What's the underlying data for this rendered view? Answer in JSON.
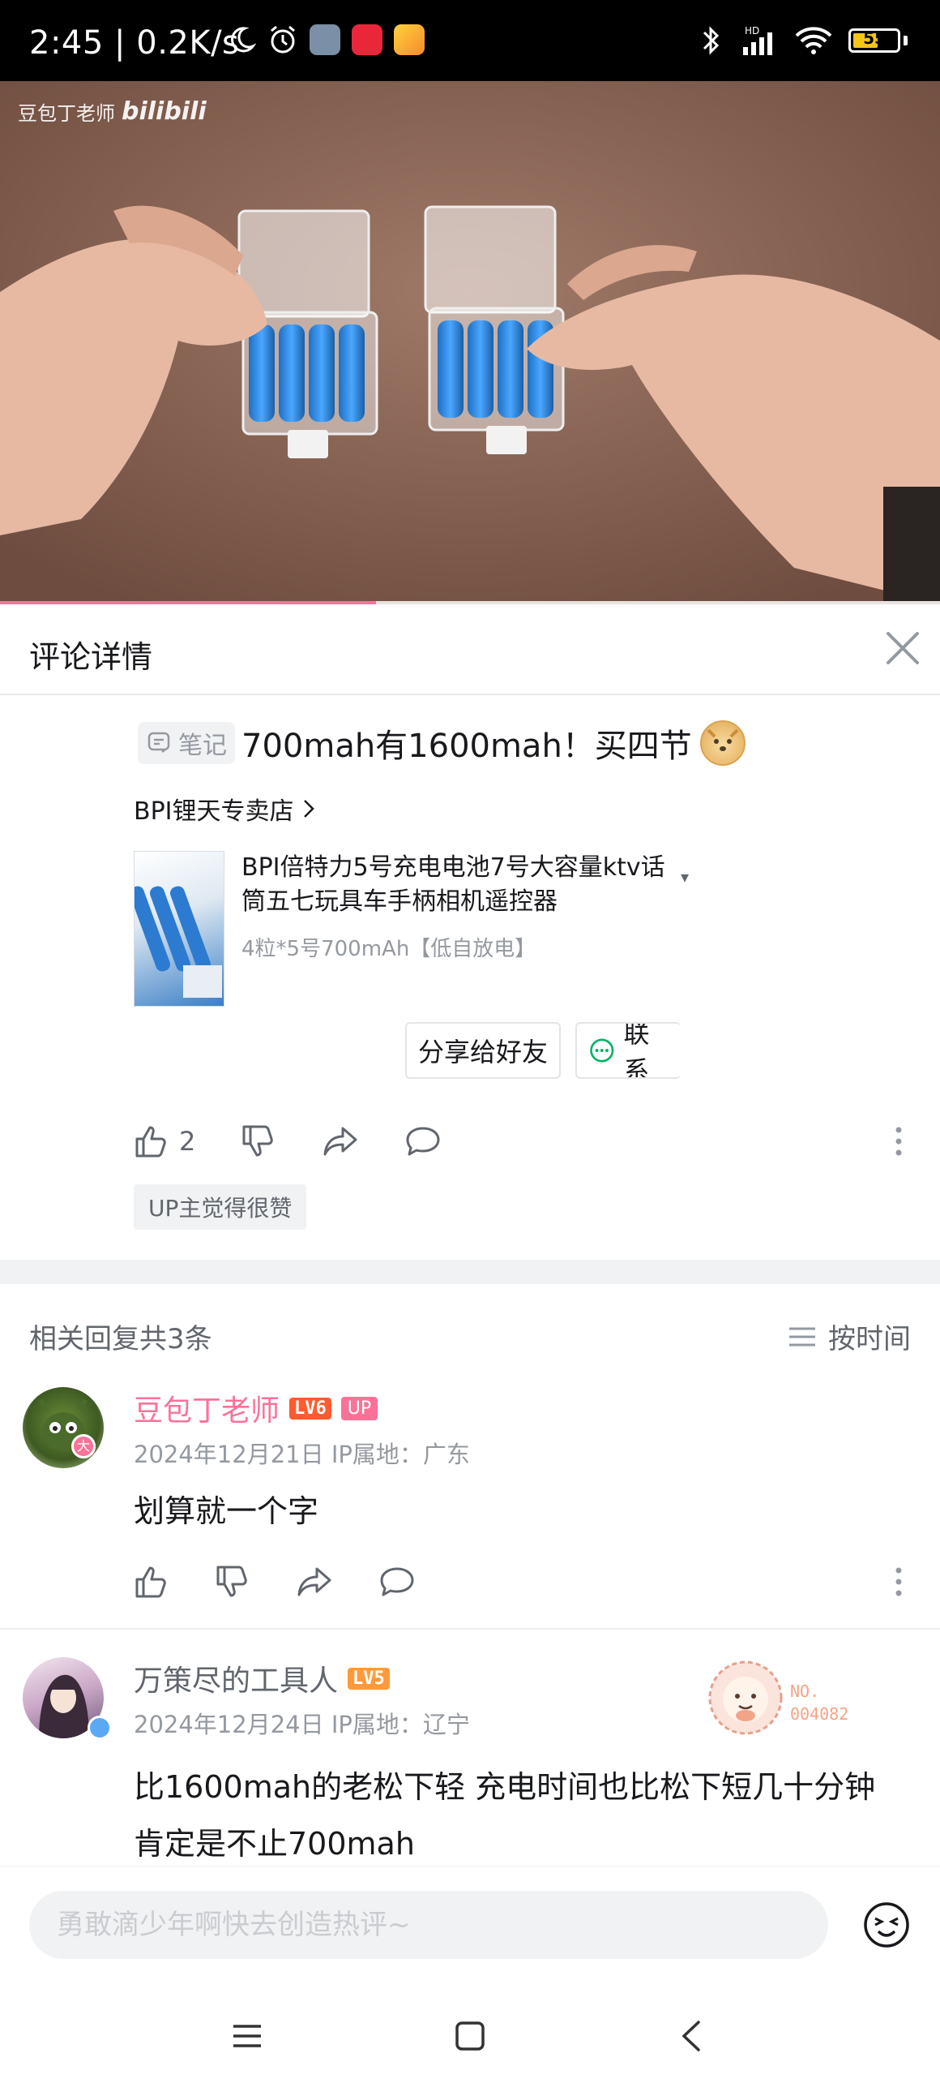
{
  "status_bar": {
    "time": "2:45",
    "speed": "| 0.2K/s",
    "battery": "55",
    "network": "HD"
  },
  "video": {
    "watermark_author": "豆包丁老师",
    "watermark_brand": "bilibili",
    "progress": 0.4
  },
  "panel": {
    "title": "评论详情"
  },
  "main_comment": {
    "note_tag": "笔记",
    "text": "700mah有1600mah！买四节",
    "store_name": "BPI锂天专卖店",
    "product_title": "BPI倍特力5号充电电池7号大容量ktv话筒五七玩具车手柄相机遥控器",
    "product_spec": "4粒*5号700mAh【低自放电】",
    "share_btn": "分享给好友",
    "contact_btn": "联系",
    "like_count": "2",
    "up_badge": "UP主觉得很赞"
  },
  "replies_header": {
    "count_label": "相关回复共3条",
    "sort_label": "按时间"
  },
  "replies": [
    {
      "name": "豆包丁老师",
      "level": "LV6",
      "up_tag": "UP",
      "date": "2024年12月21日",
      "ip": "IP属地：广东",
      "text": "划算就一个字",
      "avatar_badge": "大"
    },
    {
      "name": "万策尽的工具人",
      "level": "LV5",
      "date": "2024年12月24日",
      "ip": "IP属地：辽宁",
      "text": "比1600mah的老松下轻 充电时间也比松下短几十分钟 肯定是不止700mah",
      "fan_badge_no": "NO.",
      "fan_badge_id": "004082"
    }
  ],
  "composer": {
    "placeholder": "勇敢滴少年啊快去创造热评~"
  },
  "colors": {
    "accent_pink": "#fb7299",
    "lv6": "#ff5b2e",
    "lv5": "#ff9a3c"
  }
}
